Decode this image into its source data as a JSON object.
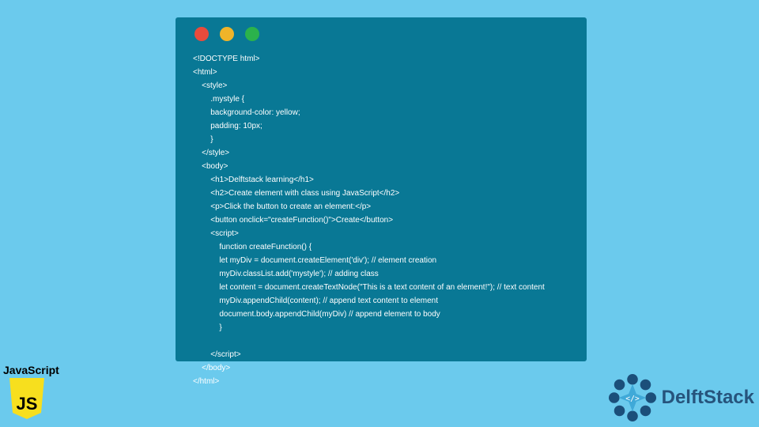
{
  "window": {
    "dots": [
      "red",
      "yellow",
      "green"
    ]
  },
  "code_lines": [
    "<!DOCTYPE html>",
    "<html>",
    "    <style>",
    "        .mystyle {",
    "        background-color: yellow;",
    "        padding: 10px;",
    "        }",
    "    </style>",
    "    <body>",
    "        <h1>Delftstack learning</h1>",
    "        <h2>Create element with class using JavaScript</h2>",
    "        <p>Click the button to create an element:</p>",
    "        <button onclick=\"createFunction()\">Create</button>",
    "        <script>",
    "            function createFunction() {",
    "            let myDiv = document.createElement('div'); // element creation",
    "            myDiv.classList.add('mystyle'); // adding class",
    "            let content = document.createTextNode(\"This is a text content of an element!\"); // text content",
    "            myDiv.appendChild(content); // append text content to element",
    "            document.body.appendChild(myDiv) // append element to body",
    "            }",
    "",
    "        </script>",
    "    </body>",
    "</html>"
  ],
  "js_badge": {
    "label": "JavaScript",
    "shield_text": "JS"
  },
  "brand": {
    "name": "DelftStack"
  },
  "colors": {
    "page_bg": "#6bcaed",
    "window_bg": "#097895",
    "brand": "#26547c",
    "js_yellow": "#f7df1e"
  }
}
